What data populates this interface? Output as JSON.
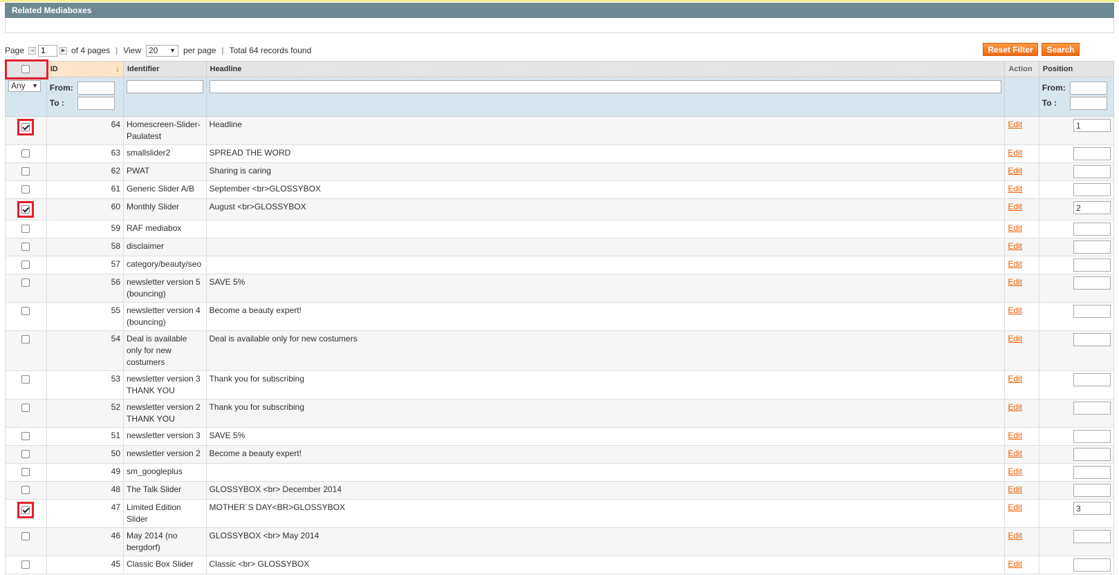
{
  "section": {
    "title": "Related Mediaboxes"
  },
  "pager": {
    "page_label": "Page",
    "page_value": "1",
    "of_pages": "of 4 pages",
    "view_label": "View",
    "per_page_value": "20",
    "per_page_label": "per page",
    "total": "Total 64 records found"
  },
  "buttons": {
    "reset_filter": "Reset Filter",
    "search": "Search"
  },
  "columns": {
    "id": "ID",
    "identifier": "Identifier",
    "headline": "Headline",
    "action": "Action",
    "position": "Position"
  },
  "filter": {
    "any": "Any",
    "from": "From:",
    "to": "To :"
  },
  "colors": {
    "accent": "#f47a20",
    "link": "#eb5e00",
    "highlight": "#e41f2b",
    "header": "#6f8992"
  },
  "rows": [
    {
      "id": "64",
      "identifier": "Homescreen-Slider-Paulatest",
      "headline": "Headline",
      "action": "Edit",
      "position": "1",
      "checked": true
    },
    {
      "id": "63",
      "identifier": "smallslider2",
      "headline": "SPREAD THE WORD",
      "action": "Edit",
      "position": "",
      "checked": false
    },
    {
      "id": "62",
      "identifier": "PWAT",
      "headline": "Sharing is caring",
      "action": "Edit",
      "position": "",
      "checked": false
    },
    {
      "id": "61",
      "identifier": "Generic Slider A/B",
      "headline": "September <br>GLOSSYBOX",
      "action": "Edit",
      "position": "",
      "checked": false
    },
    {
      "id": "60",
      "identifier": "Monthly Slider",
      "headline": "August <br>GLOSSYBOX",
      "action": "Edit",
      "position": "2",
      "checked": true
    },
    {
      "id": "59",
      "identifier": "RAF mediabox",
      "headline": "",
      "action": "Edit",
      "position": "",
      "checked": false
    },
    {
      "id": "58",
      "identifier": "disclaimer",
      "headline": "",
      "action": "Edit",
      "position": "",
      "checked": false
    },
    {
      "id": "57",
      "identifier": "category/beauty/seo",
      "headline": "",
      "action": "Edit",
      "position": "",
      "checked": false
    },
    {
      "id": "56",
      "identifier": "newsletter version 5 (bouncing)",
      "headline": "SAVE 5%",
      "action": "Edit",
      "position": "",
      "checked": false
    },
    {
      "id": "55",
      "identifier": "newsletter version 4 (bouncing)",
      "headline": "Become a beauty expert!",
      "action": "Edit",
      "position": "",
      "checked": false
    },
    {
      "id": "54",
      "identifier": "Deal is available only for new costumers",
      "headline": "Deal is available only for new costumers",
      "action": "Edit",
      "position": "",
      "checked": false
    },
    {
      "id": "53",
      "identifier": "newsletter version 3 THANK YOU",
      "headline": "Thank you for subscribing",
      "action": "Edit",
      "position": "",
      "checked": false
    },
    {
      "id": "52",
      "identifier": "newsletter version 2 THANK YOU",
      "headline": "Thank you for subscribing",
      "action": "Edit",
      "position": "",
      "checked": false
    },
    {
      "id": "51",
      "identifier": "newsletter version 3",
      "headline": "SAVE 5%",
      "action": "Edit",
      "position": "",
      "checked": false
    },
    {
      "id": "50",
      "identifier": "newsletter version 2",
      "headline": "Become a beauty expert!",
      "action": "Edit",
      "position": "",
      "checked": false
    },
    {
      "id": "49",
      "identifier": "sm_googleplus",
      "headline": "",
      "action": "Edit",
      "position": "",
      "checked": false
    },
    {
      "id": "48",
      "identifier": "The Talk Slider",
      "headline": "GLOSSYBOX <br> December 2014",
      "action": "Edit",
      "position": "",
      "checked": false
    },
    {
      "id": "47",
      "identifier": "Limited Edition Slider",
      "headline": "MOTHER´S DAY<BR>GLOSSYBOX",
      "action": "Edit",
      "position": "3",
      "checked": true
    },
    {
      "id": "46",
      "identifier": "May 2014 (no bergdorf)",
      "headline": "GLOSSYBOX <br> May 2014",
      "action": "Edit",
      "position": "",
      "checked": false
    },
    {
      "id": "45",
      "identifier": "Classic Box Slider",
      "headline": "Classic <br> GLOSSYBOX",
      "action": "Edit",
      "position": "",
      "checked": false
    }
  ]
}
